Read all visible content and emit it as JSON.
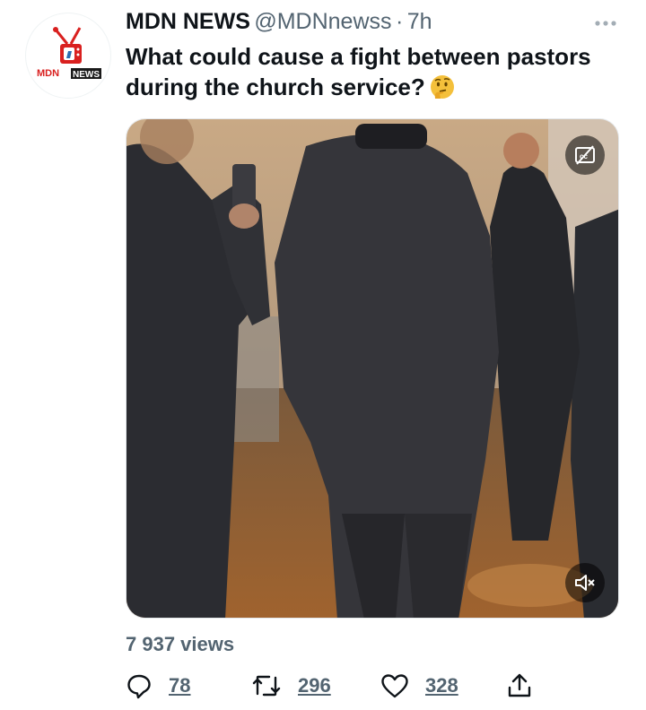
{
  "tweet": {
    "display_name": "MDN NEWS",
    "handle": "@MDNnewss",
    "separator": "·",
    "time": "7h",
    "text": "What could cause a fight between pastors during the church service?",
    "emoji": "thinking-face"
  },
  "avatar": {
    "logo_text_left": "MDN",
    "logo_text_right": "NEWS",
    "brand_colors": {
      "red": "#d9201f",
      "black": "#1a1a1a",
      "blue": "#2b6cb0"
    }
  },
  "media": {
    "type": "video",
    "captions_icon": "closed-captions-icon",
    "mute_icon": "speaker-muted-icon"
  },
  "stats": {
    "views_text": "7 937 views"
  },
  "actions": {
    "reply_count": "78",
    "retweet_count": "296",
    "like_count": "328",
    "share_icon": "share-icon"
  },
  "colors": {
    "text_primary": "#0f1419",
    "text_secondary": "#536471"
  }
}
